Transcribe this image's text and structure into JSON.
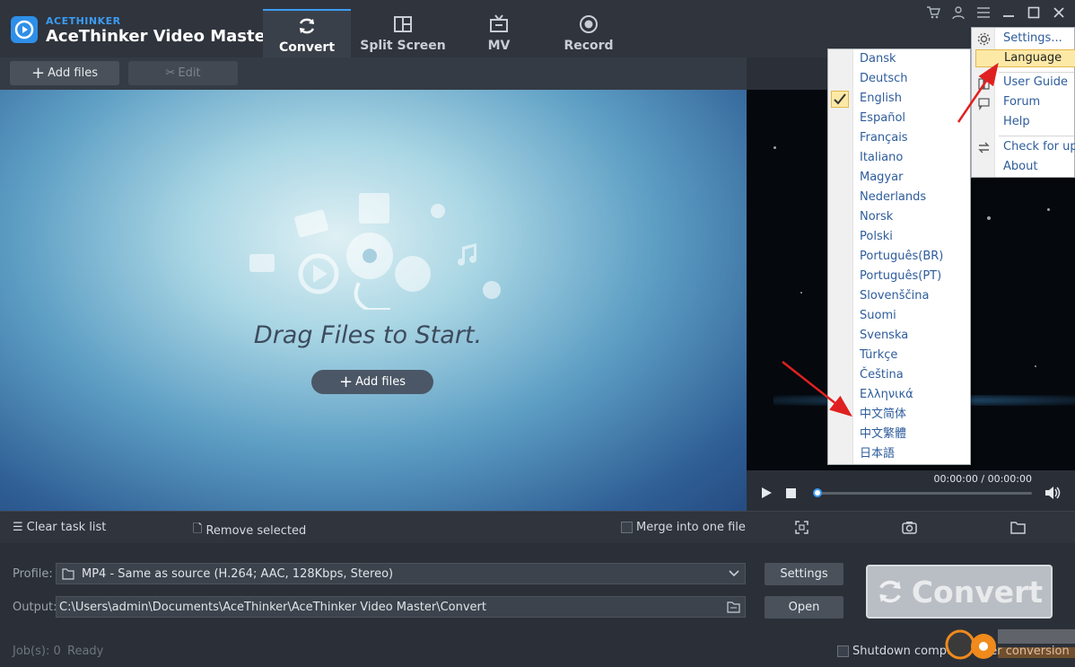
{
  "app": {
    "brand_small": "ACETHINKER",
    "brand_big": "AceThinker Video Master"
  },
  "tabs": [
    {
      "label": "Convert",
      "icon": "refresh-icon",
      "active": true
    },
    {
      "label": "Split Screen",
      "icon": "split-screen-icon",
      "active": false
    },
    {
      "label": "MV",
      "icon": "tv-icon",
      "active": false
    },
    {
      "label": "Record",
      "icon": "record-icon",
      "active": false
    }
  ],
  "window_icons": [
    "cart-icon",
    "user-icon",
    "menu-list-icon",
    "minimize-icon",
    "maximize-icon",
    "close-icon"
  ],
  "toolbar": {
    "add_files": "Add files",
    "edit": "Edit"
  },
  "droparea": {
    "drag_text": "Drag Files to Start.",
    "add_files": "Add files"
  },
  "player": {
    "time": "00:00:00 / 00:00:00",
    "progress": 0
  },
  "taskbar": {
    "clear": "Clear task list",
    "remove": "Remove selected",
    "merge": "Merge into one file"
  },
  "bottom": {
    "profile_label": "Profile:",
    "profile_value": "MP4 - Same as source (H.264; AAC, 128Kbps, Stereo)",
    "output_label": "Output:",
    "output_value": "C:\\Users\\admin\\Documents\\AceThinker\\AceThinker Video Master\\Convert",
    "settings_btn": "Settings",
    "open_btn": "Open",
    "convert_btn": "Convert",
    "jobs": "Job(s): 0",
    "ready": "Ready",
    "shutdown": "Shutdown computer after conversion"
  },
  "language_menu": {
    "selected": "English",
    "items": [
      "Dansk",
      "Deutsch",
      "English",
      "Español",
      "Français",
      "Italiano",
      "Magyar",
      "Nederlands",
      "Norsk",
      "Polski",
      "Português(BR)",
      "Português(PT)",
      "Slovenščina",
      "Suomi",
      "Svenska",
      "Türkçe",
      "Čeština",
      "Ελληνικά",
      "中文简体",
      "中文繁體",
      "日本語"
    ]
  },
  "settings_menu": {
    "settings": "Settings...",
    "language": "Language",
    "user_guide": "User Guide",
    "forum": "Forum",
    "help": "Help",
    "check_update": "Check for upd",
    "about": "About"
  },
  "colors": {
    "accent": "#3c9cf2",
    "highlight": "#fde9a6",
    "arrow": "#e02020"
  }
}
